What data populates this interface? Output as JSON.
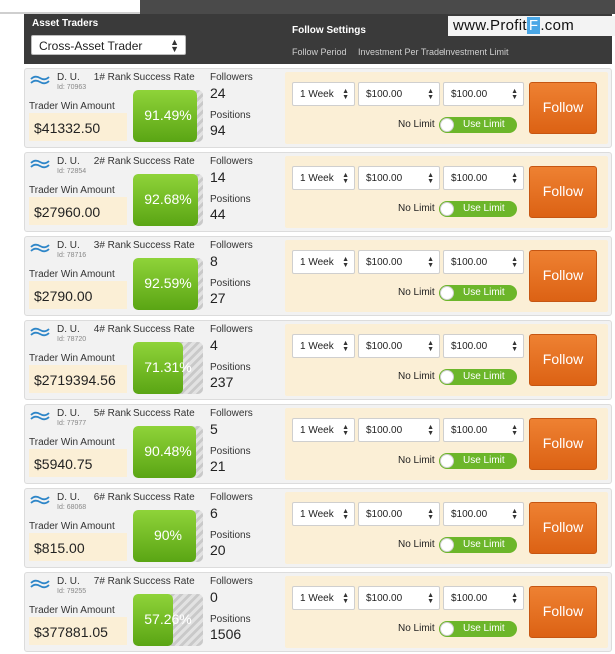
{
  "header": {
    "asset_traders_label": "Asset Traders",
    "trader_type_selected": "Cross-Asset Trader",
    "follow_settings_label": "Follow Settings",
    "columns": [
      "Follow Period",
      "Investment Per Trade",
      "Investment Limit"
    ]
  },
  "watermark": {
    "prefix": "www.Profit",
    "highlight": "F",
    "suffix": ".com"
  },
  "labels": {
    "success_rate": "Success Rate",
    "followers": "Followers",
    "positions": "Positions",
    "trader_win_amount": "Trader Win Amount",
    "no_limit": "No Limit",
    "use_limit": "Use Limit",
    "follow": "Follow",
    "rank_suffix": "# Rank"
  },
  "traders": [
    {
      "name": "D. U.",
      "rank": "1",
      "id": "Id: 70963",
      "win_amount": "$41332.50",
      "success_rate": "91.49%",
      "success_fraction": 0.9149,
      "followers": "24",
      "positions": "94",
      "period": "1 Week",
      "investment": "$100.00",
      "limit": "$100.00"
    },
    {
      "name": "D. U.",
      "rank": "2",
      "id": "Id: 72854",
      "win_amount": "$27960.00",
      "success_rate": "92.68%",
      "success_fraction": 0.9268,
      "followers": "14",
      "positions": "44",
      "period": "1 Week",
      "investment": "$100.00",
      "limit": "$100.00"
    },
    {
      "name": "D. U.",
      "rank": "3",
      "id": "Id: 78716",
      "win_amount": "$2790.00",
      "success_rate": "92.59%",
      "success_fraction": 0.9259,
      "followers": "8",
      "positions": "27",
      "period": "1 Week",
      "investment": "$100.00",
      "limit": "$100.00"
    },
    {
      "name": "D. U.",
      "rank": "4",
      "id": "Id: 78720",
      "win_amount": "$2719394.56",
      "success_rate": "71.31%",
      "success_fraction": 0.7131,
      "followers": "4",
      "positions": "237",
      "period": "1 Week",
      "investment": "$100.00",
      "limit": "$100.00"
    },
    {
      "name": "D. U.",
      "rank": "5",
      "id": "Id: 77977",
      "win_amount": "$5940.75",
      "success_rate": "90.48%",
      "success_fraction": 0.9048,
      "followers": "5",
      "positions": "21",
      "period": "1 Week",
      "investment": "$100.00",
      "limit": "$100.00"
    },
    {
      "name": "D. U.",
      "rank": "6",
      "id": "Id: 68068",
      "win_amount": "$815.00",
      "success_rate": "90%",
      "success_fraction": 0.9,
      "followers": "6",
      "positions": "20",
      "period": "1 Week",
      "investment": "$100.00",
      "limit": "$100.00"
    },
    {
      "name": "D. U.",
      "rank": "7",
      "id": "Id: 79255",
      "win_amount": "$377881.05",
      "success_rate": "57.26%",
      "success_fraction": 0.5726,
      "followers": "0",
      "positions": "1506",
      "period": "1 Week",
      "investment": "$100.00",
      "limit": "$100.00"
    }
  ],
  "colors": {
    "header_bg": "#3a3a3a",
    "success_green": "#6cb62a",
    "follow_orange": "#e8711f",
    "settings_bg": "#fbefd6",
    "watermark_blue": "#4aa7e6"
  }
}
